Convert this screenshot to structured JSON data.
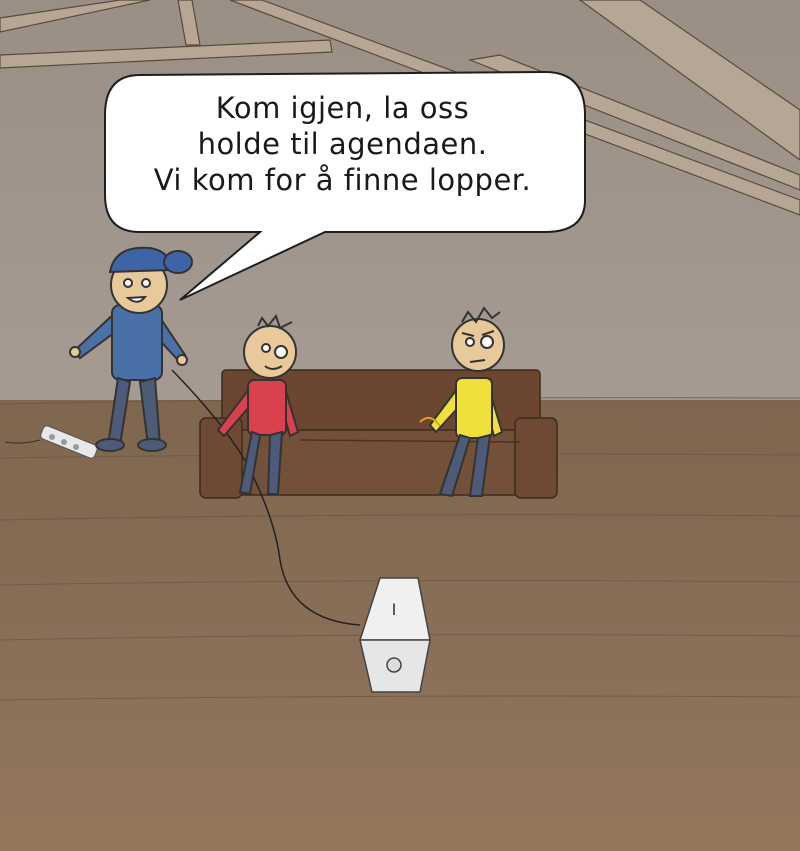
{
  "speech_bubble": {
    "lines": [
      "Kom igjen, la oss",
      "holde til agendaen.",
      "Vi kom for å finne lopper."
    ]
  },
  "colors": {
    "wall": "#9e9389",
    "floor": "#8a6f55",
    "sofa": "#6e4a33",
    "cap_character": "#4a70a8",
    "red_character": "#d9414f",
    "yellow_character": "#f2e03a",
    "skin": "#e8c99a"
  }
}
